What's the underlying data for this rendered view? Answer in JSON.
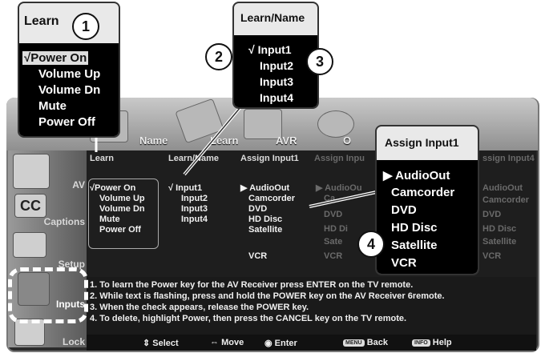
{
  "top_tabs": [
    "Name",
    "Learn",
    "AVR",
    "O"
  ],
  "sidebar": [
    {
      "label": "AV"
    },
    {
      "label": "Captions"
    },
    {
      "label": "Setup"
    },
    {
      "label": "Inputs"
    },
    {
      "label": "Lock"
    }
  ],
  "columns": [
    "Learn",
    "Learn/Name",
    "Assign Input1",
    "Assign Inpu",
    "ssign Input4"
  ],
  "learn_items": [
    "√Power On",
    "Volume Up",
    "Volume Dn",
    "Mute",
    "Power Off"
  ],
  "learnname_items": [
    "√ Input1",
    "Input2",
    "Input3",
    "Input4"
  ],
  "assign_items": [
    "▶ AudioOut",
    "Camcorder",
    "DVD",
    "HD Disc",
    "Satellite",
    "VCR"
  ],
  "assign_dim_items": [
    "▶ AudioOu",
    "Ca",
    "DVD",
    "HD Di",
    "Sate",
    "VCR"
  ],
  "assign4_items": [
    "AudioOut",
    "Camcorder",
    "DVD",
    "HD Disc",
    "Satellite",
    "VCR"
  ],
  "instructions": [
    "1. To learn the Power key for the AV Receiver press ENTER on the TV remote.",
    "2. While text is flashing, press and hold the POWER key on the AV Receiver 6remote.",
    "3. When the check appears, release the POWER key.",
    "4. To delete, highlight Power, then press the CANCEL key on the TV remote."
  ],
  "bottom_bar": {
    "select": "Select",
    "move": "Move",
    "enter": "Enter",
    "menu_key": "MENU",
    "back": "Back",
    "info_key": "INFO",
    "help": "Help"
  },
  "callout1": {
    "badge": "1",
    "title": "Learn",
    "items": [
      "√Power On",
      "Volume Up",
      "Volume Dn",
      "Mute",
      "Power Off"
    ]
  },
  "callout2": {
    "badges": [
      "2",
      "3"
    ],
    "title": "Learn/Name",
    "items": [
      "√  Input1",
      "Input2",
      "Input3",
      "Input4"
    ]
  },
  "callout4": {
    "badge": "4",
    "title": "Assign Input1",
    "items": [
      "▶ AudioOut",
      "Camcorder",
      "DVD",
      "HD Disc",
      "Satellite",
      "VCR"
    ]
  }
}
